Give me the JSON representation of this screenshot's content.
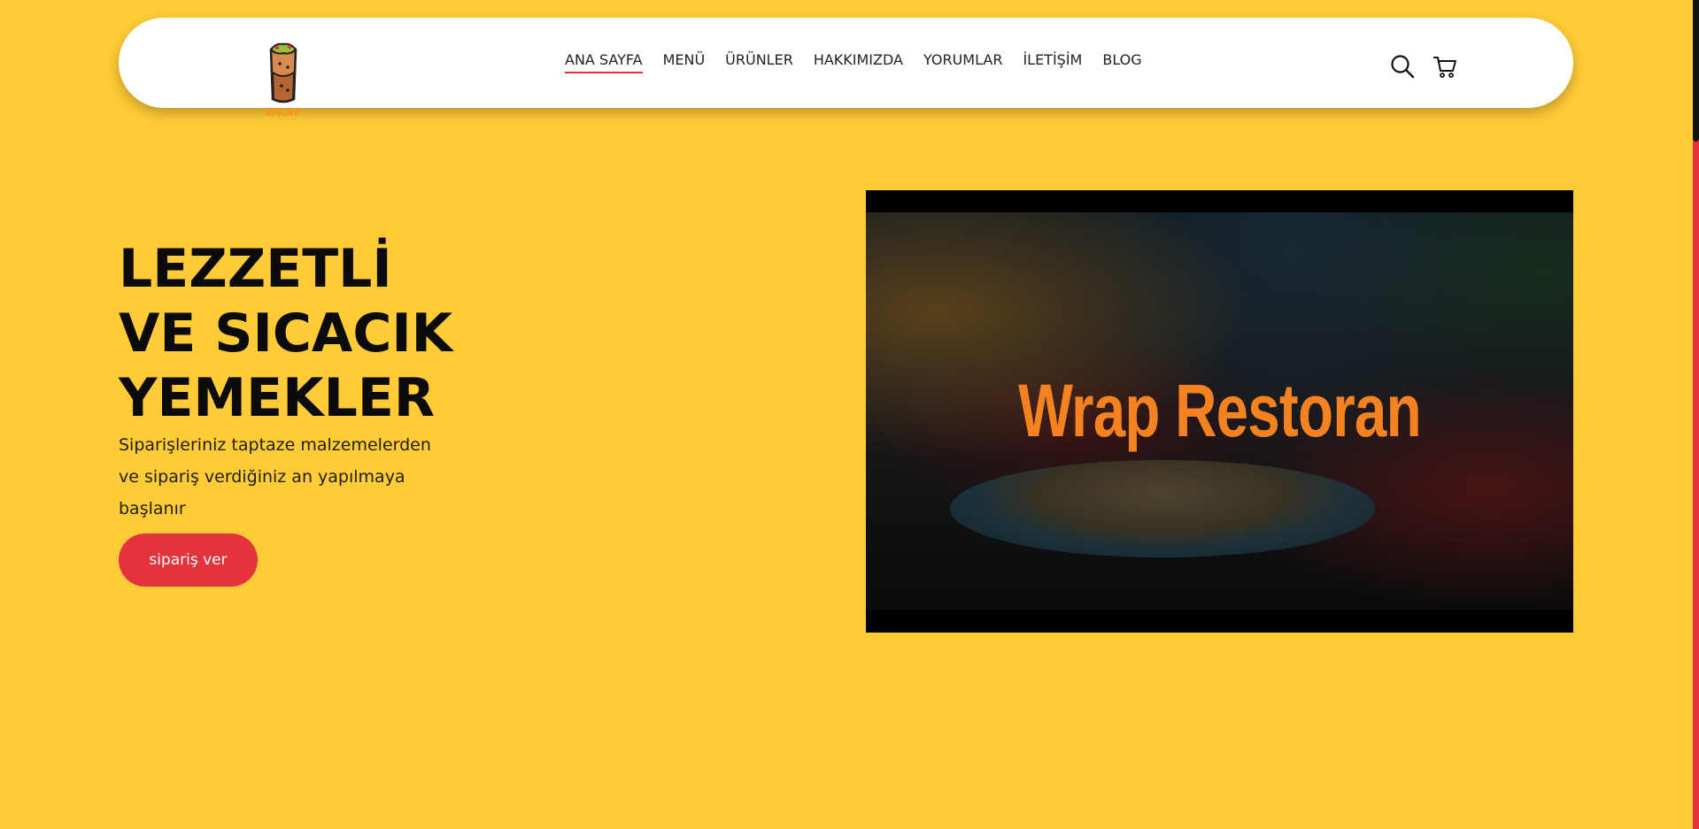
{
  "logo": {
    "text": "WRAP",
    "icon": "wrap-burrito-icon"
  },
  "nav": {
    "items": [
      {
        "label": "ANA SAYFA",
        "active": true
      },
      {
        "label": "MENÜ",
        "active": false
      },
      {
        "label": "ÜRÜNLER",
        "active": false
      },
      {
        "label": "HAKKIMIZDA",
        "active": false
      },
      {
        "label": "YORUMLAR",
        "active": false
      },
      {
        "label": "İLETİŞİM",
        "active": false
      },
      {
        "label": "BLOG",
        "active": false
      }
    ]
  },
  "header_icons": {
    "search": "search-icon",
    "cart": "cart-icon"
  },
  "hero": {
    "title_lines": [
      "LEZZETLİ",
      "VE SICACIK",
      "YEMEKLER"
    ],
    "subtitle": "Siparişleriniz taptaze malzemelerden ve sipariş verdiğiniz an yapılmaya başlanır",
    "button_label": "sipariş ver"
  },
  "video": {
    "overlay_title": "Wrap Restoran"
  },
  "colors": {
    "background": "#FFCB36",
    "accent_red": "#E3343D",
    "brand_orange": "#F58220",
    "header_bg": "#FFFFFF"
  }
}
